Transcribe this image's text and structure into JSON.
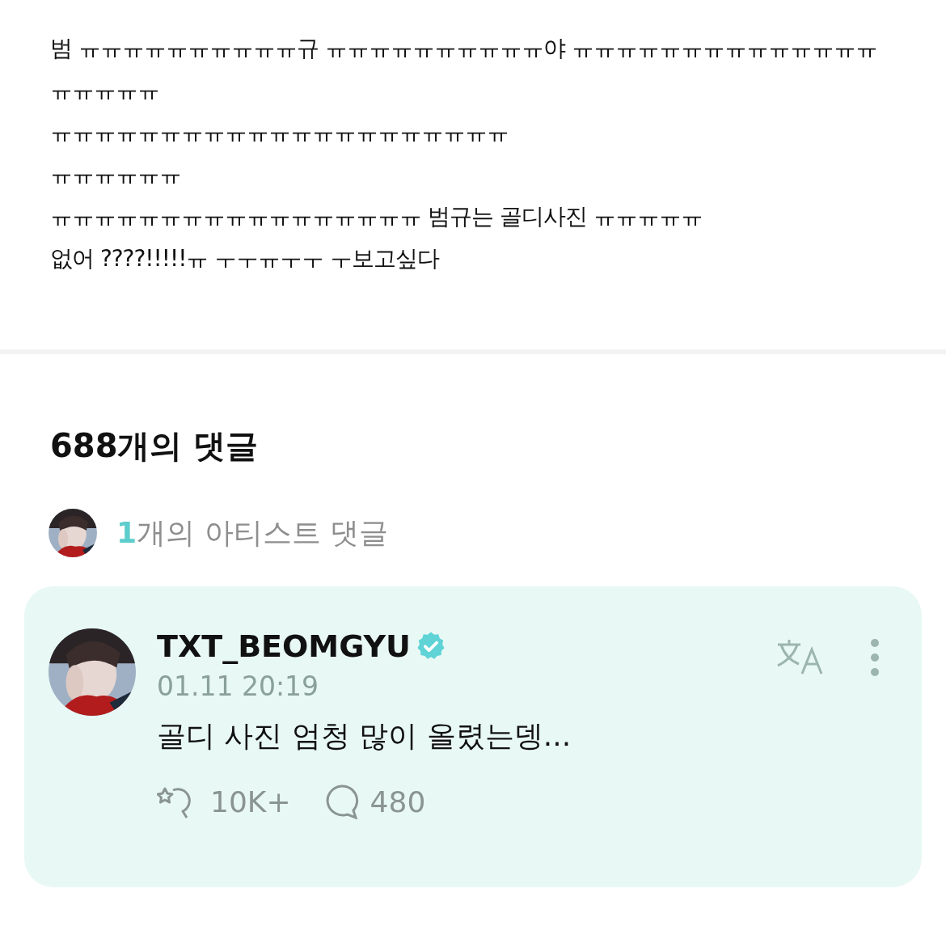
{
  "post": {
    "lines": [
      "범 ㅠㅠㅠㅠㅠㅠㅠㅠㅠㅠ규 ㅠㅠㅠㅠㅠㅠㅠㅠㅠㅠ야 ㅠㅠㅠㅠㅠㅠㅠㅠㅠㅠㅠㅠㅠㅠ",
      "ㅠㅠㅠㅠㅠ",
      "ㅠㅠㅠㅠㅠㅠㅠㅠㅠㅠㅠㅠㅠㅠㅠㅠㅠㅠㅠㅠㅠ",
      "ㅠㅠㅠㅠㅠㅠ",
      "ㅠㅠㅠㅠㅠㅠㅠㅠㅠㅠㅠㅠㅠㅠㅠㅠㅠ 범규는 골디사진 ㅠㅠㅠㅠㅠ",
      "없어 ????!!!!!ㅠ ㅜㅜㅠㅜㅜ ㅜ보고싶다"
    ]
  },
  "comments": {
    "heading": "688개의 댓글",
    "artist_summary": {
      "count": "1",
      "label": "개의 아티스트 댓글"
    },
    "artist_comment": {
      "author": "TXT_BEOMGYU",
      "verified": true,
      "time": "01.11 20:19",
      "text": "골디 사진 엄청 많이 올렸는뎅...",
      "likes": "10K+",
      "replies": "480"
    }
  }
}
